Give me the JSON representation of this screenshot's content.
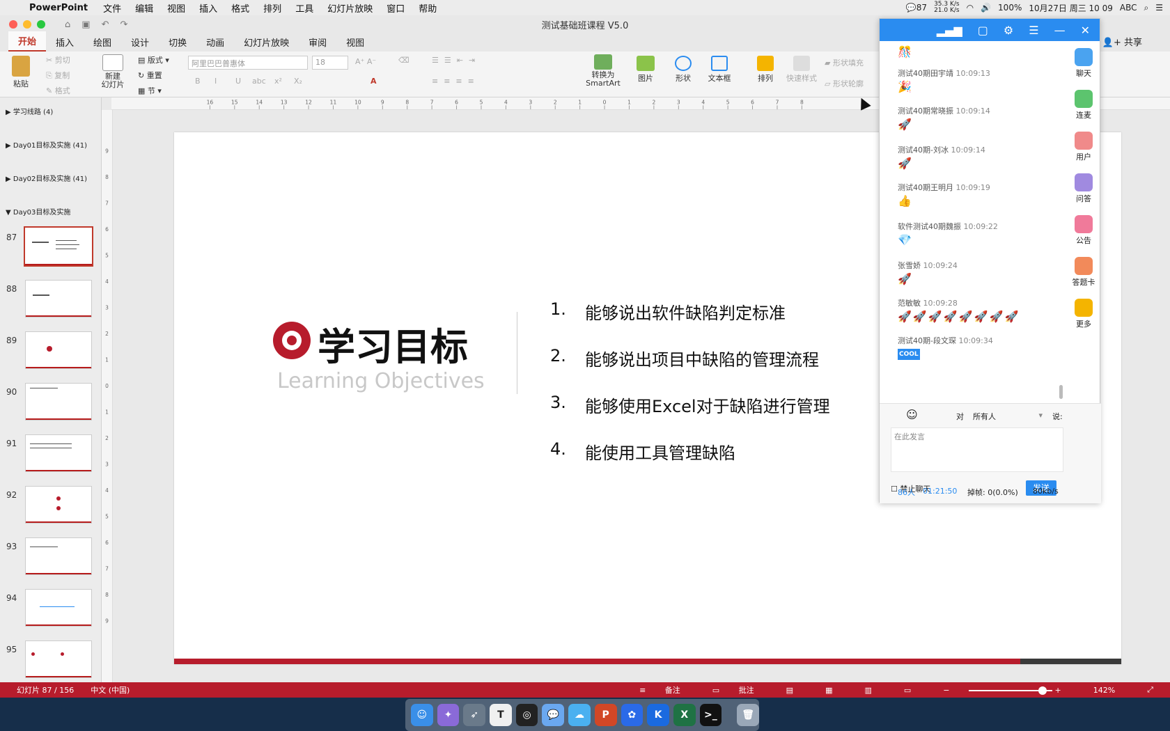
{
  "menubar": {
    "app": "PowerPoint",
    "items": [
      "文件",
      "编辑",
      "视图",
      "插入",
      "格式",
      "排列",
      "工具",
      "幻灯片放映",
      "窗口",
      "帮助"
    ],
    "badge_count": "87",
    "net_up": "35.3 K/s",
    "net_down": "21.0 K/s",
    "battery": "100%",
    "datetime": "10月27日 周三 10 09",
    "input_method": "ABC"
  },
  "window": {
    "title": "测试基础班课程 V5.0"
  },
  "ribbon_tabs": [
    "开始",
    "插入",
    "绘图",
    "设计",
    "切换",
    "动画",
    "幻灯片放映",
    "审阅",
    "视图"
  ],
  "share_label": "共享",
  "ribbon": {
    "paste": "粘贴",
    "cut": "剪切",
    "copy": "复制",
    "format": "格式",
    "new_slide": "新建\n幻灯片",
    "layout": "版式",
    "reset": "重置",
    "section": "节",
    "font_name": "阿里巴巴普惠体",
    "font_size": "18",
    "bold": "B",
    "italic": "I",
    "underline": "U",
    "strike": "abc",
    "super": "x²",
    "sub": "X₂",
    "convert_smartart": "转换为\nSmartArt",
    "picture": "图片",
    "shape": "形状",
    "textbox": "文本框",
    "arrange": "排列",
    "quick_style": "快速样式",
    "shape_fill": "形状填充",
    "shape_outline": "形状轮廓"
  },
  "ruler": {
    "h": [
      "16",
      "15",
      "14",
      "13",
      "12",
      "11",
      "10",
      "9",
      "8",
      "7",
      "6",
      "5",
      "4",
      "3",
      "2",
      "1",
      "0",
      "1",
      "2",
      "3",
      "4",
      "5",
      "6",
      "7",
      "8"
    ],
    "v": [
      "9",
      "8",
      "7",
      "6",
      "5",
      "4",
      "3",
      "2",
      "1",
      "0",
      "1",
      "2",
      "3",
      "4",
      "5",
      "6",
      "7",
      "8",
      "9"
    ]
  },
  "sections": [
    {
      "label": "学习线路 (4)"
    },
    {
      "label": "Day01目标及实施 (41)"
    },
    {
      "label": "Day02目标及实施 (41)"
    },
    {
      "label": "Day03目标及实施"
    }
  ],
  "thumbnails": [
    "87",
    "88",
    "89",
    "90",
    "91",
    "92",
    "93",
    "94",
    "95"
  ],
  "slide": {
    "title": "学习目标",
    "subtitle": "Learning Objectives",
    "objectives": [
      {
        "num": "1.",
        "text": "能够说出软件缺陷判定标准"
      },
      {
        "num": "2.",
        "text": "能够说出项目中缺陷的管理流程"
      },
      {
        "num": "3.",
        "text": "能够使用Excel对于缺陷进行管理"
      },
      {
        "num": "4.",
        "text": "能使用工具管理缺陷"
      }
    ]
  },
  "chat": {
    "messages": [
      {
        "name": "测试40期田宇靖",
        "time": "10:09:13",
        "emoji": "🎉"
      },
      {
        "name": "测试40期常晓振",
        "time": "10:09:14",
        "emoji": "🚀"
      },
      {
        "name": "测试40期-刘冰",
        "time": "10:09:14",
        "emoji": "🚀"
      },
      {
        "name": "测试40期王明月",
        "time": "10:09:19",
        "emoji": "👍"
      },
      {
        "name": "软件测试40期魏振",
        "time": "10:09:22",
        "emoji": "💎"
      },
      {
        "name": "张雪娇",
        "time": "10:09:24",
        "emoji": "🚀"
      },
      {
        "name": "范敏敏",
        "time": "10:09:28",
        "emoji": "🚀🚀🚀🚀🚀🚀🚀🚀"
      },
      {
        "name": "测试40期-段文琛",
        "time": "10:09:34",
        "emoji": "COOL"
      }
    ],
    "side": [
      "聊天",
      "连麦",
      "用户",
      "问答",
      "公告",
      "答题卡",
      "更多"
    ],
    "to_label": "对",
    "target": "所有人",
    "say": "说:",
    "placeholder": "在此发言",
    "mute_label": "禁止聊天",
    "send": "发送",
    "stats": {
      "people": "86人",
      "duration": "01:21:50",
      "drop": "掉帧: 0(0.0%)",
      "rate": "80kb/s"
    }
  },
  "status": {
    "slide": "幻灯片 87 / 156",
    "lang": "中文 (中国)",
    "notes": "备注",
    "comments": "批注",
    "zoom": "142%"
  },
  "colors": {
    "accent": "#b71c2c",
    "chat_blue": "#2a8cf0"
  }
}
